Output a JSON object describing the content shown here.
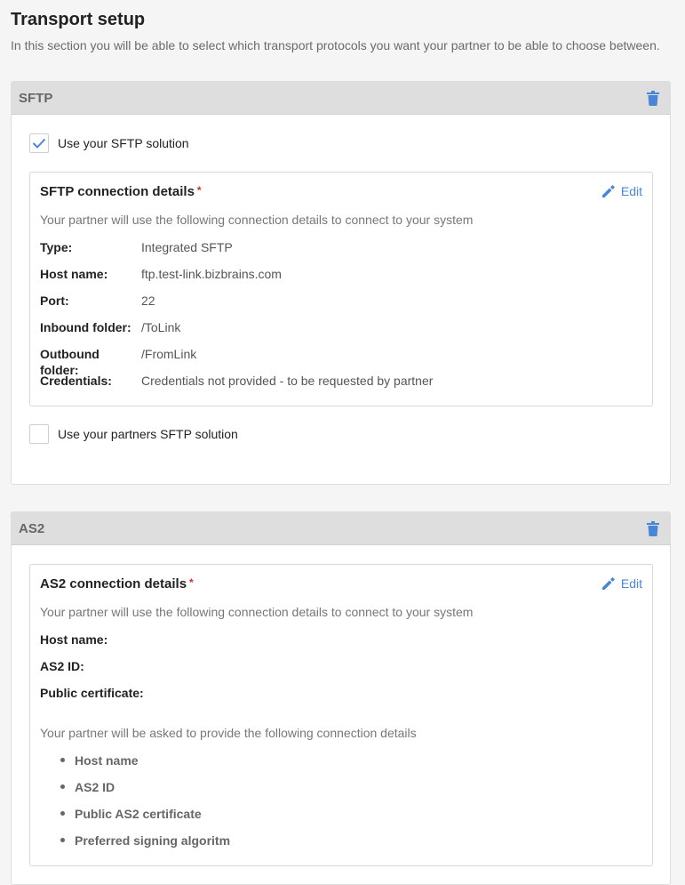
{
  "page": {
    "title": "Transport setup",
    "subtitle": "In this section you will be able to select which transport protocols you want your partner to be able to choose between."
  },
  "sftp": {
    "section_title": "SFTP",
    "use_own_label": "Use your SFTP solution",
    "use_own_checked": true,
    "use_partner_label": "Use your partners SFTP solution",
    "use_partner_checked": false,
    "card": {
      "title": "SFTP connection details",
      "required_mark": "*",
      "edit_label": "Edit",
      "description": "Your partner will use the following connection details to connect to your system",
      "fields": [
        {
          "label": "Type:",
          "value": "Integrated SFTP"
        },
        {
          "label": "Host name:",
          "value": "ftp.test-link.bizbrains.com"
        },
        {
          "label": "Port:",
          "value": "22"
        },
        {
          "label": "Inbound folder:",
          "value": "/ToLink"
        },
        {
          "label": "Outbound folder:",
          "value": "/FromLink"
        },
        {
          "label": "Credentials:",
          "value": "Credentials not provided - to be requested by partner"
        }
      ]
    }
  },
  "as2": {
    "section_title": "AS2",
    "card": {
      "title": "AS2 connection details",
      "required_mark": "*",
      "edit_label": "Edit",
      "description": "Your partner will use the following connection details to connect to your system",
      "fields": [
        {
          "label": "Host name:",
          "value": ""
        },
        {
          "label": "AS2 ID:",
          "value": ""
        },
        {
          "label": "Public certificate:",
          "value": ""
        }
      ],
      "partner_description": "Your partner will be asked to provide the following connection details",
      "partner_items": [
        "Host name",
        "AS2 ID",
        "Public AS2 certificate",
        "Preferred signing algoritm"
      ]
    }
  },
  "colors": {
    "accent": "#4a86d8",
    "error": "#d32f2f",
    "section_header": "#dedede"
  },
  "icons": {
    "trash": "trash-icon",
    "edit": "pencil-icon",
    "check": "checkmark-icon"
  }
}
